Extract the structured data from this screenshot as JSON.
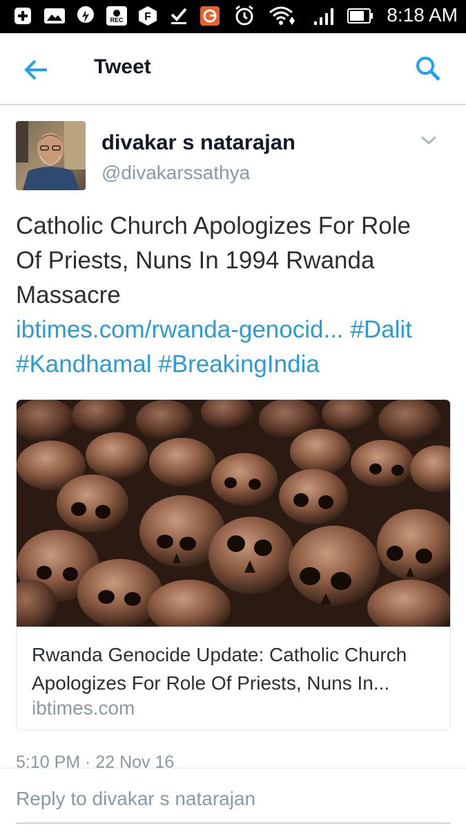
{
  "status_bar": {
    "time": "8:18 AM",
    "icons": [
      "add-box-icon",
      "gallery-icon",
      "speed-icon",
      "rec-icon",
      "f-app-icon",
      "download-done-icon",
      "g-app-icon",
      "alarm-icon",
      "wifi-icon",
      "signal-icon",
      "battery-icon"
    ]
  },
  "app_bar": {
    "title": "Tweet",
    "back_icon": "arrow-back-icon",
    "search_icon": "search-icon",
    "accent_color": "#1da1f2"
  },
  "tweet": {
    "author_name": "divakar s natarajan",
    "author_handle": "@divakarssathya",
    "text_lines": [
      "Catholic Church Apologizes For Role",
      "Of Priests, Nuns In 1994 Rwanda",
      "Massacre"
    ],
    "link_text": "ibtimes.com/rwanda-genocid...",
    "hashtags": [
      "#Dalit",
      "#Kandhamal",
      "#BreakingIndia"
    ],
    "timestamp": "5:10 PM · 22 Nov 16"
  },
  "card": {
    "image_description_icon": "skulls-photo",
    "title_lines": [
      "Rwanda Genocide Update: Catholic Church",
      "Apologizes For Role Of Priests, Nuns In..."
    ],
    "domain": "ibtimes.com"
  },
  "reply": {
    "placeholder": "Reply to divakar s natarajan"
  }
}
